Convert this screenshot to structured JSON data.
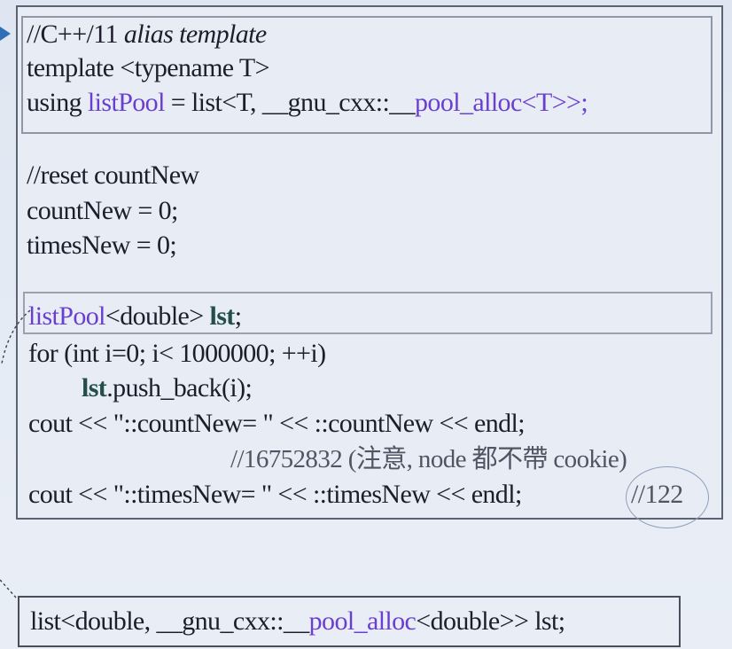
{
  "slide": {
    "alias_comment_prefix": "//C++/11 ",
    "alias_comment_italic": "alias template",
    "template_line": "template <typename T>",
    "using_line": {
      "prefix": "using ",
      "name": "listPool",
      "middle": " = list<T, __gnu_cxx::__",
      "alloc": "pool_alloc",
      "suffix": "<T>>;"
    },
    "reset_comment": "//reset countNew",
    "count_new_line": "countNew = 0;",
    "times_new_line": "timesNew = 0;",
    "decl_line": {
      "type": "listPool",
      "middle": "<double> ",
      "var": "lst",
      "suffix": ";"
    },
    "for_line": "for (int i=0; i< 1000000; ++i)",
    "push_line": {
      "var": "lst",
      "suffix": ".push_back(i);"
    },
    "cout_count_line": "cout << \"::countNew= \" << ::countNew << endl;",
    "count_result_comment": "//16752832 (注意, node 都不帶 cookie)",
    "cout_times_line": "cout << \"::timesNew= \" << ::timesNew << endl;",
    "times_result_comment": "//122",
    "bottom_line": {
      "prefix": "list<double, __gnu_cxx::__",
      "alloc": "pool_alloc",
      "suffix": "<double>> lst;"
    }
  }
}
